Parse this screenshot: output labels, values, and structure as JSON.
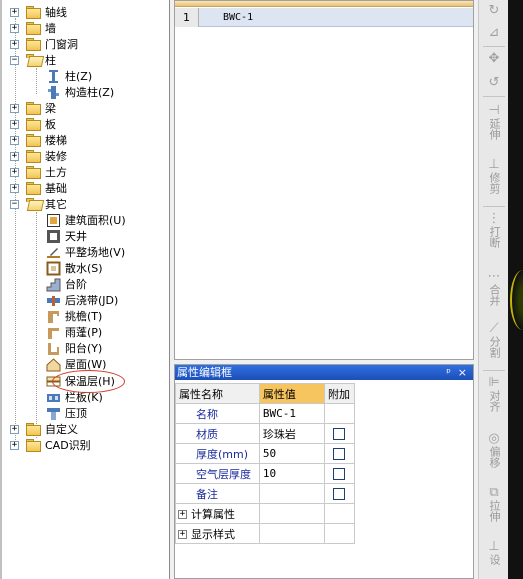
{
  "tree": {
    "items": [
      {
        "label": "轴线",
        "expander": "+",
        "folder": "closed"
      },
      {
        "label": "墙",
        "expander": "+",
        "folder": "closed"
      },
      {
        "label": "门窗洞",
        "expander": "+",
        "folder": "closed"
      },
      {
        "label": "柱",
        "expander": "−",
        "folder": "open"
      },
      {
        "label": "柱(Z)",
        "icon": "column-icon"
      },
      {
        "label": "构造柱(Z)",
        "icon": "constructional-column-icon"
      },
      {
        "label": "梁",
        "expander": "+",
        "folder": "closed"
      },
      {
        "label": "板",
        "expander": "+",
        "folder": "closed"
      },
      {
        "label": "楼梯",
        "expander": "+",
        "folder": "closed"
      },
      {
        "label": "装修",
        "expander": "+",
        "folder": "closed"
      },
      {
        "label": "土方",
        "expander": "+",
        "folder": "closed"
      },
      {
        "label": "基础",
        "expander": "+",
        "folder": "closed"
      },
      {
        "label": "其它",
        "expander": "−",
        "folder": "open"
      },
      {
        "label": "建筑面积(U)",
        "icon": "building-area-icon"
      },
      {
        "label": "天井",
        "icon": "courtyard-icon"
      },
      {
        "label": "平整场地(V)",
        "icon": "site-leveling-icon"
      },
      {
        "label": "散水(S)",
        "icon": "apron-icon"
      },
      {
        "label": "台阶",
        "icon": "steps-icon"
      },
      {
        "label": "后浇带(JD)",
        "icon": "post-cast-strip-icon"
      },
      {
        "label": "挑檐(T)",
        "icon": "cornice-icon"
      },
      {
        "label": "雨蓬(P)",
        "icon": "canopy-icon"
      },
      {
        "label": "阳台(Y)",
        "icon": "balcony-icon"
      },
      {
        "label": "屋面(W)",
        "icon": "roof-icon"
      },
      {
        "label": "保温层(H)",
        "icon": "insulation-layer-icon"
      },
      {
        "label": "栏板(K)",
        "icon": "parapet-icon"
      },
      {
        "label": "压顶",
        "icon": "coping-icon"
      },
      {
        "label": "自定义",
        "expander": "+",
        "folder": "closed"
      },
      {
        "label": "CAD识别",
        "expander": "+",
        "folder": "closed"
      }
    ]
  },
  "component_list": {
    "rows": [
      {
        "num": "1",
        "name": "BWC-1"
      }
    ]
  },
  "property_panel": {
    "title": "属性编辑框",
    "pin_glyph": "ᵖ",
    "close_glyph": "×",
    "headers": {
      "name": "属性名称",
      "value": "属性值",
      "extra": "附加"
    },
    "rows": [
      {
        "name": "名称",
        "value": "BWC-1",
        "has_checkbox": false
      },
      {
        "name": "材质",
        "value": "珍珠岩",
        "has_checkbox": true
      },
      {
        "name": "厚度(mm)",
        "value": "50",
        "has_checkbox": true
      },
      {
        "name": "空气层厚度",
        "value": "10",
        "has_checkbox": true
      },
      {
        "name": "备注",
        "value": "",
        "has_checkbox": true
      }
    ],
    "groups": [
      {
        "label": "计算属性"
      },
      {
        "label": "显示样式"
      }
    ]
  },
  "toolbar": {
    "buttons": [
      {
        "icon": "rotate-icon",
        "label": ""
      },
      {
        "icon": "mirror-icon",
        "label": ""
      },
      {
        "icon": "move-icon",
        "label": ""
      },
      {
        "icon": "undo-rotate-icon",
        "label": ""
      },
      {
        "icon": "extend-icon",
        "label": "延伸"
      },
      {
        "icon": "trim-icon",
        "label": "修剪"
      },
      {
        "icon": "break-icon",
        "label": "打断"
      },
      {
        "icon": "merge-icon",
        "label": "合并"
      },
      {
        "icon": "split-icon",
        "label": "分割"
      },
      {
        "icon": "align-icon",
        "label": "对齐"
      },
      {
        "icon": "offset-icon",
        "label": "偏移"
      },
      {
        "icon": "stretch-icon",
        "label": "拉伸"
      },
      {
        "icon": "settings-icon",
        "label": "设"
      }
    ]
  },
  "colors": {
    "title_bar": "#2f6fe0",
    "value_header": "#f7c560",
    "property_name": "#1a2a9a",
    "annotation": "#d23a2a"
  }
}
